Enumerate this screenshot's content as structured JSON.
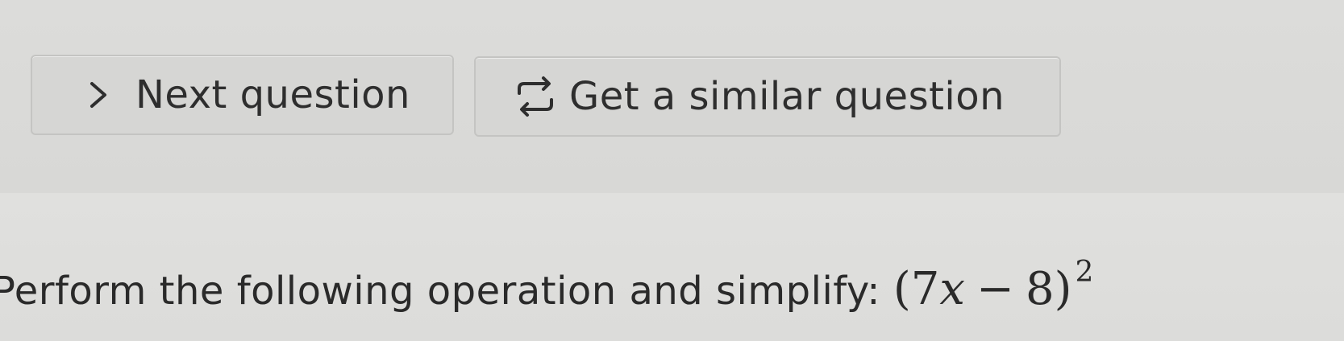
{
  "buttons": {
    "next": {
      "label": "Next question",
      "icon": "chevron-right-icon"
    },
    "similar": {
      "label": "Get a similar question",
      "icon": "repeat-arrows-icon"
    }
  },
  "question": {
    "prompt": "Perform the following operation and simplify:",
    "expression": {
      "open_paren": "(",
      "coefficient": "7",
      "variable": "x",
      "operator": "−",
      "constant": "8",
      "close_paren": ")",
      "exponent": "2"
    }
  },
  "colors": {
    "background": "#d9d9d7",
    "button_bg": "#d6d6d4",
    "button_border": "#c4c4c2",
    "text": "#2c2c2c"
  }
}
